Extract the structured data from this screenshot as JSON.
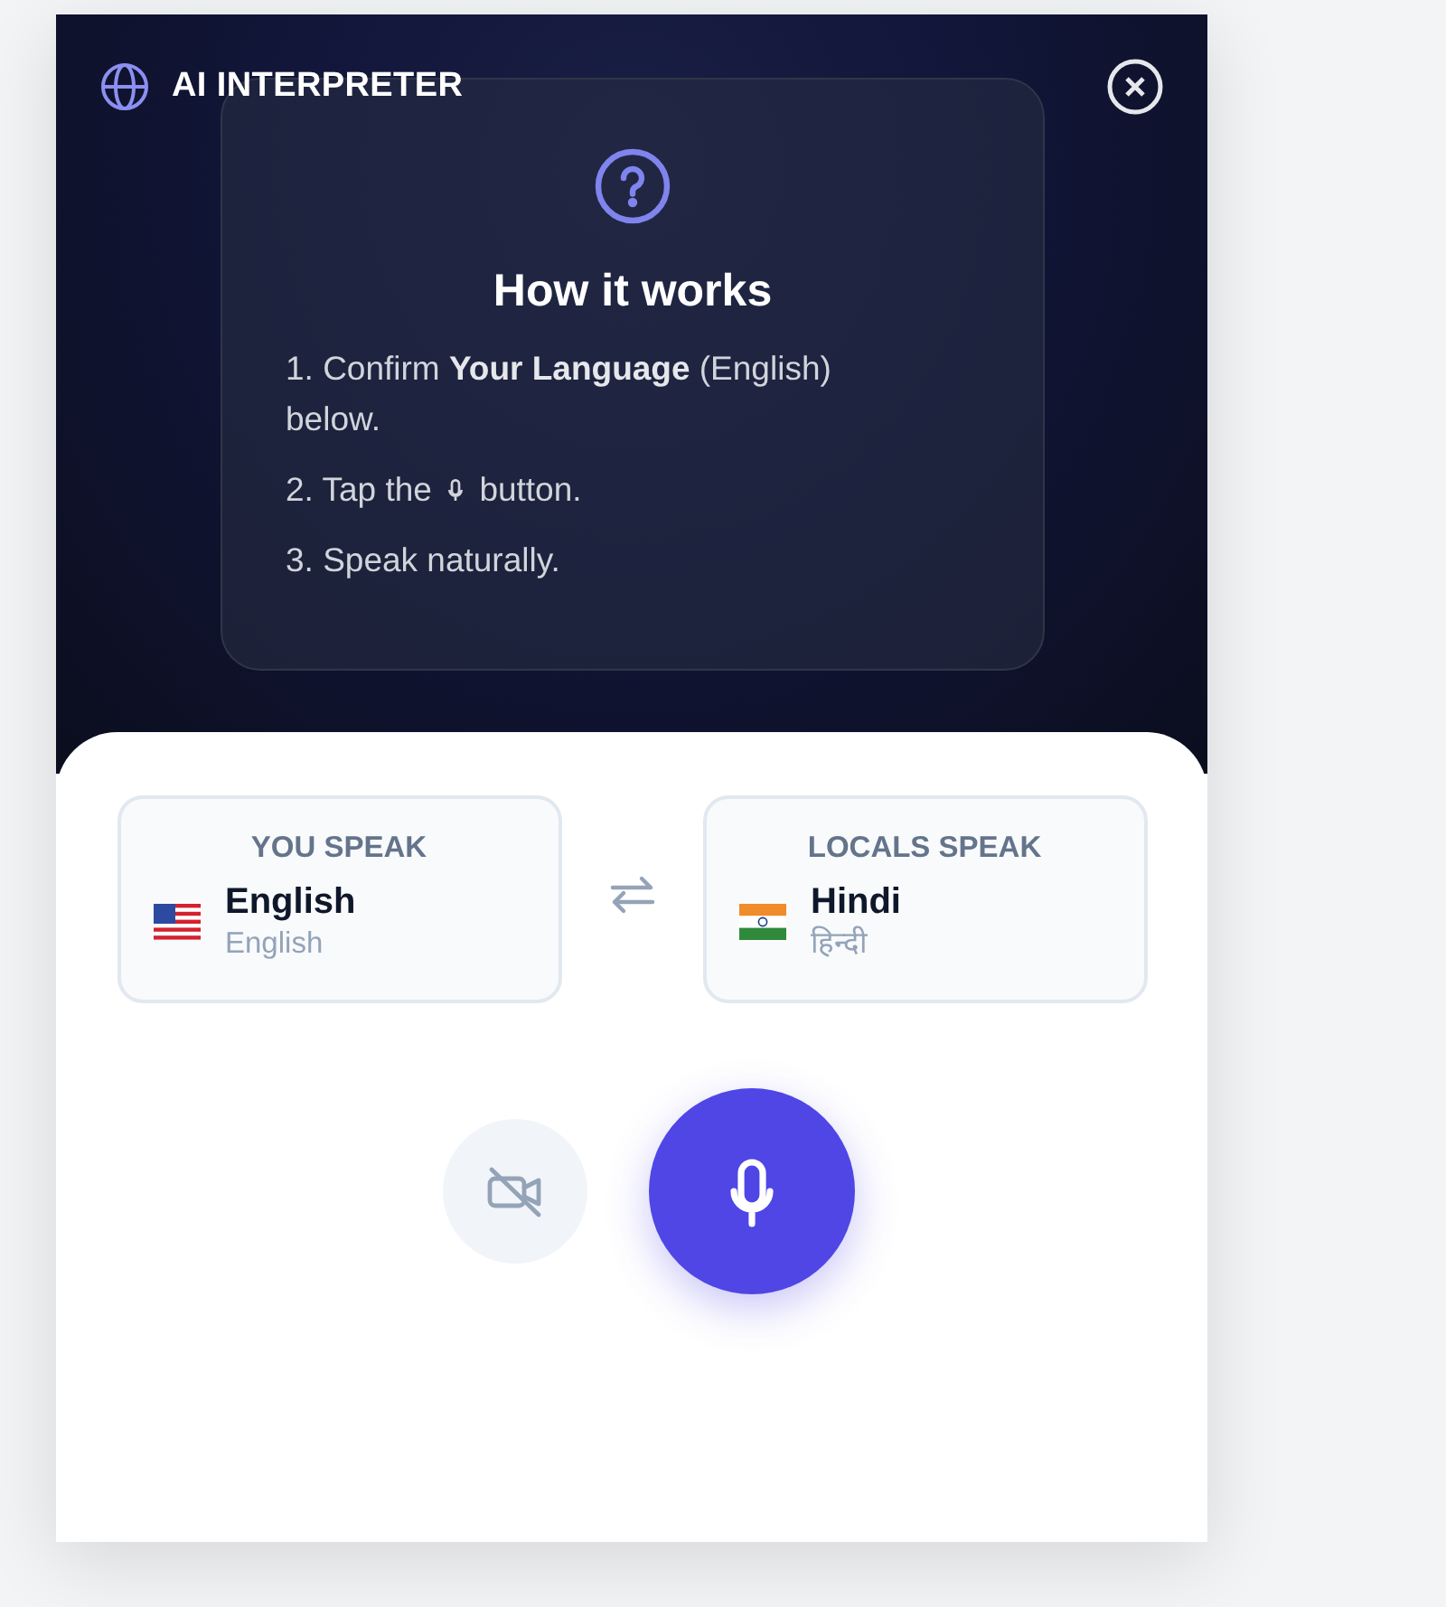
{
  "header": {
    "title": "AI INTERPRETER"
  },
  "help": {
    "title": "How it works",
    "steps": [
      {
        "kind": "text",
        "text": "1. Confirm **Your Language** (English) below."
      },
      {
        "kind": "icon",
        "before": "2. Tap the",
        "after": "button."
      },
      {
        "kind": "text",
        "text": "3. Speak naturally."
      }
    ]
  },
  "languages": [
    {
      "label": "YOU SPEAK",
      "kind": "us",
      "name": "English",
      "native": "English"
    },
    {
      "label": "LOCALS SPEAK",
      "kind": "in",
      "name": "Hindi",
      "native": "हिन्दी"
    }
  ],
  "controls": {
    "video_enabled": false
  }
}
